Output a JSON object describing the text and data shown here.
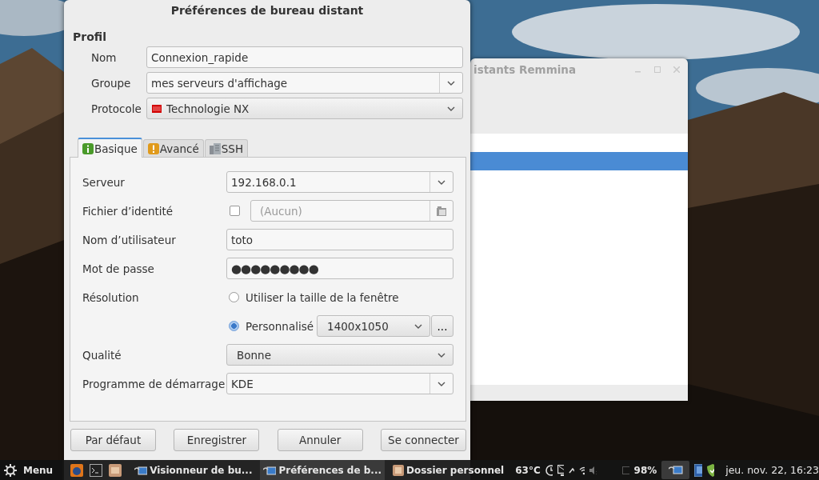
{
  "background_window": {
    "title": "istants Remmina",
    "rows": [
      {
        "selected": false
      },
      {
        "selected": true
      }
    ]
  },
  "dialog": {
    "title": "Préférences de bureau distant",
    "section": "Profil",
    "profile_fields": [
      {
        "label": "Nom",
        "kind": "text",
        "value": "Connexion_rapide"
      },
      {
        "label": "Groupe",
        "kind": "combo",
        "value": "mes serveurs d'affichage"
      },
      {
        "label": "Protocole",
        "kind": "select",
        "value": "Technologie NX"
      }
    ],
    "tabs": [
      {
        "label": "Basique",
        "selected": true
      },
      {
        "label": "Avancé",
        "selected": false
      },
      {
        "label": "SSH",
        "selected": false
      }
    ],
    "fields": [
      {
        "label": "Serveur",
        "kind": "combo",
        "value": "192.168.0.1"
      },
      {
        "label": "Fichier d’identité",
        "kind": "file",
        "checked": false,
        "placeholder": "(Aucun)"
      },
      {
        "label": "Nom d’utilisateur",
        "kind": "text",
        "value": "toto"
      },
      {
        "label": "Mot de passe",
        "kind": "password",
        "value": "●●●●●●●●●"
      },
      {
        "label": "Résolution",
        "kind": "radio",
        "options": [
          {
            "label": "Utiliser la taille de la fenêtre",
            "selected": false
          },
          {
            "label": "Personnalisé",
            "selected": true,
            "value": "1400x1050",
            "button": "..."
          }
        ]
      },
      {
        "label": "Qualité",
        "kind": "select",
        "value": "Bonne"
      },
      {
        "label": "Programme de démarrage",
        "kind": "combo",
        "value": "KDE"
      }
    ],
    "buttons": [
      "Par défaut",
      "Enregistrer",
      "Annuler",
      "Se connecter"
    ]
  },
  "taskbar": {
    "menu": "Menu",
    "tasks": [
      {
        "label": "Visionneur de bu...",
        "selected": false
      },
      {
        "label": "Préférences de b...",
        "selected": true
      },
      {
        "label": "Dossier personnel",
        "selected": false
      }
    ],
    "temperature": "63°C",
    "battery": "98%",
    "clock": "jeu. nov. 22, 16:23"
  }
}
